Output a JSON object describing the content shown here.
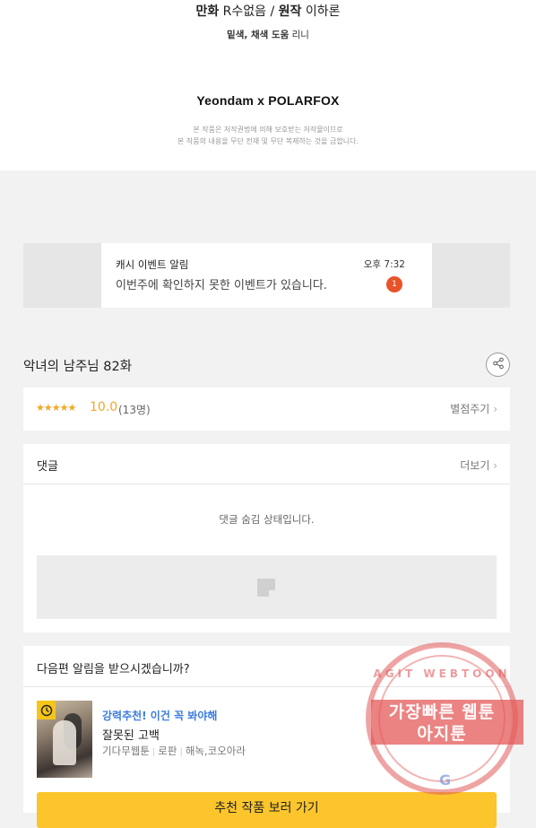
{
  "credits": {
    "art_label": "만화",
    "art_name": "R수없음",
    "sep": "/",
    "original_label": "원작",
    "original_name": "이하론",
    "assist_label": "밑색, 채색 도움",
    "assist_name": "리니",
    "brand": "Yeondam x POLARFOX",
    "copyright_line1": "본 작품은 저작권법에 의해 보호받는 저작물이므로",
    "copyright_line2": "본 작품의 내용을 무단 전재 및 무단 복제하는 것을 금합니다."
  },
  "banner": {
    "title": "캐시 이벤트 알림",
    "time": "오후 7:32",
    "message": "이번주에 확인하지 못한 이벤트가 있습니다.",
    "badge_count": "1"
  },
  "episode": {
    "title": "악녀의 남주님 82화",
    "share_icon": "share-icon"
  },
  "rating": {
    "stars": "★★★★★",
    "stars_value": 5,
    "score": "10.0",
    "count": "(13명)",
    "rate_link": "별점주기"
  },
  "comments": {
    "title": "댓글",
    "more": "더보기",
    "hidden_message": "댓글 숨김 상태입니다."
  },
  "next_alert": {
    "question": "다음편 알림을 받으시겠습니까?"
  },
  "recommend": {
    "tag": "강력추천! 이건 꼭 봐야해",
    "name": "잘못된 고백",
    "meta1": "기다무웹툰",
    "meta2": "로판",
    "meta3": "해녹,코오아라",
    "button": "추천 작품 보러 가기"
  },
  "watermark": {
    "arc": "AGIT WEBTOON",
    "line1": "가장빠른 웹툰",
    "line2": "아지툰",
    "google": "G"
  },
  "colors": {
    "accent_star": "#f5a623",
    "badge": "#e8532a",
    "button": "#fbc52b",
    "rec_tag": "#3b7ce0"
  }
}
